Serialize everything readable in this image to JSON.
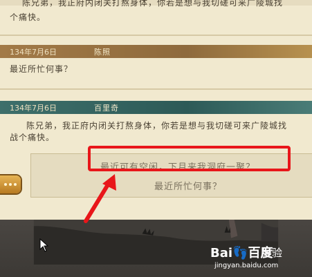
{
  "messages": [
    {
      "date": "",
      "sender": "",
      "lines": [
        "陈兄弟，我正府内闭关打熬身体，你若是想与我切磋可来广陵城找",
        "个痛快。"
      ]
    },
    {
      "date": "134年7月6日",
      "sender": "陈照",
      "lines": [
        "最近所忙何事？"
      ]
    },
    {
      "date": "134年7月6日",
      "sender": "百里奇",
      "lines": [
        "陈兄弟，我正府内闭关打熬身体，你若是想与我切磋可来广陵城找",
        "战个痛快。"
      ]
    }
  ],
  "reply_options": [
    "最近可有空闲，下月来我洞府一聚？",
    "最近所忙何事？"
  ],
  "watermark": {
    "logo": "Bai👣百度",
    "jy": "经验",
    "url": "jingyan.baidu.com"
  },
  "colors": {
    "highlight": "#e8161a",
    "panel": "#f1e9cf",
    "header_gold": "#a27a47",
    "header_teal": "#3e6f6b"
  }
}
